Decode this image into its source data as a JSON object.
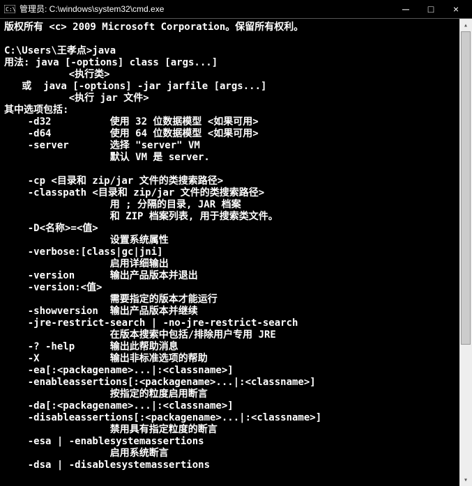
{
  "title": "管理员: C:\\windows\\system32\\cmd.exe",
  "winControls": {
    "min": "─",
    "max": "□",
    "close": "×"
  },
  "scrollbar": {
    "up": "▴",
    "down": "▾",
    "thumbTop": 18,
    "thumbHeight": 450
  },
  "lines": [
    "版权所有 <c> 2009 Microsoft Corporation。保留所有权利。",
    "",
    "C:\\Users\\王孝点>java",
    "用法: java [-options] class [args...]",
    "           <执行类>",
    "   或  java [-options] -jar jarfile [args...]",
    "           <执行 jar 文件>",
    "其中选项包括:",
    "    -d32          使用 32 位数据模型 <如果可用>",
    "    -d64          使用 64 位数据模型 <如果可用>",
    "    -server       选择 \"server\" VM",
    "                  默认 VM 是 server.",
    "",
    "    -cp <目录和 zip/jar 文件的类搜索路径>",
    "    -classpath <目录和 zip/jar 文件的类搜索路径>",
    "                  用 ; 分隔的目录, JAR 档案",
    "                  和 ZIP 档案列表, 用于搜索类文件。",
    "    -D<名称>=<值>",
    "                  设置系统属性",
    "    -verbose:[class|gc|jni]",
    "                  启用详细输出",
    "    -version      输出产品版本并退出",
    "    -version:<值>",
    "                  需要指定的版本才能运行",
    "    -showversion  输出产品版本并继续",
    "    -jre-restrict-search | -no-jre-restrict-search",
    "                  在版本搜索中包括/排除用户专用 JRE",
    "    -? -help      输出此帮助消息",
    "    -X            输出非标准选项的帮助",
    "    -ea[:<packagename>...|:<classname>]",
    "    -enableassertions[:<packagename>...|:<classname>]",
    "                  按指定的粒度启用断言",
    "    -da[:<packagename>...|:<classname>]",
    "    -disableassertions[:<packagename>...|:<classname>]",
    "                  禁用具有指定粒度的断言",
    "    -esa | -enablesystemassertions",
    "                  启用系统断言",
    "    -dsa | -disablesystemassertions"
  ]
}
